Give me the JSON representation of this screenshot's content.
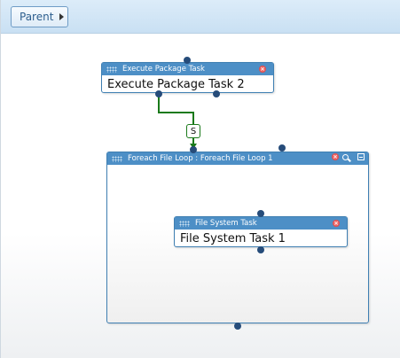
{
  "toolbar": {
    "parent_label": "Parent"
  },
  "execute_task": {
    "type_label": "Execute Package Task",
    "name": "Execute Package Task 2"
  },
  "foreach_loop": {
    "header_label": "Foreach File Loop : Foreach File Loop 1"
  },
  "file_system_task": {
    "type_label": "File System Task",
    "name": "File System Task 1"
  },
  "connector": {
    "label": "S",
    "color": "#1a7a1a"
  },
  "icons": [
    "grip-icon",
    "close-icon",
    "zoom-icon",
    "collapse-icon",
    "chevron-right-icon"
  ]
}
